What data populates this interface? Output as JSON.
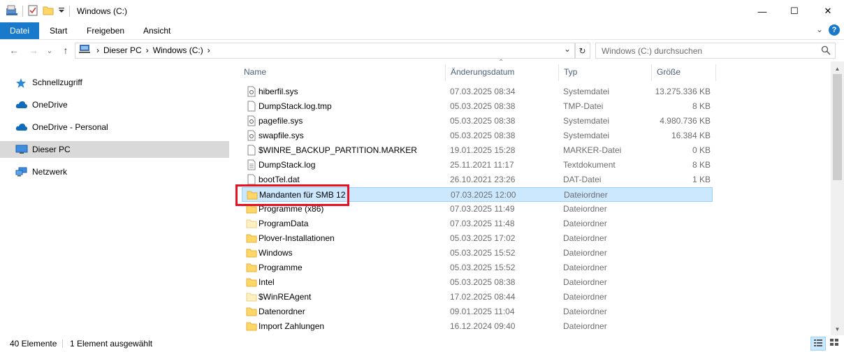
{
  "window": {
    "title": "Windows (C:)",
    "minimize_glyph": "—",
    "maximize_glyph": "☐",
    "close_glyph": "✕"
  },
  "ribbon": {
    "tabs": [
      {
        "label": "Datei",
        "active": true
      },
      {
        "label": "Start"
      },
      {
        "label": "Freigeben"
      },
      {
        "label": "Ansicht"
      }
    ],
    "expand_glyph": "⌄",
    "help_glyph": "?"
  },
  "nav": {
    "back_glyph": "←",
    "forward_glyph": "→",
    "recent_glyph": "⌄",
    "up_glyph": "↑",
    "breadcrumb": [
      "Dieser PC",
      "Windows (C:)"
    ],
    "separator": "›",
    "dropdown_glyph": "⌄",
    "refresh_glyph": "↻"
  },
  "search": {
    "placeholder": "Windows (C:) durchsuchen",
    "value": ""
  },
  "sidebar": {
    "items": [
      {
        "label": "Schnellzugriff",
        "icon": "star-icon"
      },
      {
        "label": "OneDrive",
        "icon": "cloud-icon"
      },
      {
        "label": "OneDrive - Personal",
        "icon": "cloud-icon"
      },
      {
        "label": "Dieser PC",
        "icon": "monitor-icon",
        "selected": true
      },
      {
        "label": "Netzwerk",
        "icon": "network-icon"
      }
    ]
  },
  "columns": {
    "name": "Name",
    "date": "Änderungsdatum",
    "type": "Typ",
    "size": "Größe",
    "sort_glyph": "⌃"
  },
  "files": [
    {
      "name": "hiberfil.sys",
      "date": "07.03.2025 08:34",
      "type": "Systemdatei",
      "size": "13.275.336 KB",
      "kind": "sys"
    },
    {
      "name": "DumpStack.log.tmp",
      "date": "05.03.2025 08:38",
      "type": "TMP-Datei",
      "size": "8 KB",
      "kind": "file"
    },
    {
      "name": "pagefile.sys",
      "date": "05.03.2025 08:38",
      "type": "Systemdatei",
      "size": "4.980.736 KB",
      "kind": "sys"
    },
    {
      "name": "swapfile.sys",
      "date": "05.03.2025 08:38",
      "type": "Systemdatei",
      "size": "16.384 KB",
      "kind": "sys"
    },
    {
      "name": "$WINRE_BACKUP_PARTITION.MARKER",
      "date": "19.01.2025 15:28",
      "type": "MARKER-Datei",
      "size": "0 KB",
      "kind": "file"
    },
    {
      "name": "DumpStack.log",
      "date": "25.11.2021 11:17",
      "type": "Textdokument",
      "size": "8 KB",
      "kind": "text"
    },
    {
      "name": "bootTel.dat",
      "date": "26.10.2021 23:26",
      "type": "DAT-Datei",
      "size": "1 KB",
      "kind": "file"
    },
    {
      "name": "Mandanten für SMB 12",
      "date": "07.03.2025 12:00",
      "type": "Dateiordner",
      "size": "",
      "kind": "folder",
      "selected": true
    },
    {
      "name": "Programme (x86)",
      "date": "07.03.2025 11:49",
      "type": "Dateiordner",
      "size": "",
      "kind": "folder"
    },
    {
      "name": "ProgramData",
      "date": "07.03.2025 11:48",
      "type": "Dateiordner",
      "size": "",
      "kind": "folder-light"
    },
    {
      "name": "Plover-Installationen",
      "date": "05.03.2025 17:02",
      "type": "Dateiordner",
      "size": "",
      "kind": "folder"
    },
    {
      "name": "Windows",
      "date": "05.03.2025 15:52",
      "type": "Dateiordner",
      "size": "",
      "kind": "folder"
    },
    {
      "name": "Programme",
      "date": "05.03.2025 15:52",
      "type": "Dateiordner",
      "size": "",
      "kind": "folder"
    },
    {
      "name": "Intel",
      "date": "05.03.2025 08:38",
      "type": "Dateiordner",
      "size": "",
      "kind": "folder"
    },
    {
      "name": "$WinREAgent",
      "date": "17.02.2025 08:44",
      "type": "Dateiordner",
      "size": "",
      "kind": "folder-light"
    },
    {
      "name": "Datenordner",
      "date": "09.01.2025 11:04",
      "type": "Dateiordner",
      "size": "",
      "kind": "folder"
    },
    {
      "name": "Import Zahlungen",
      "date": "16.12.2024 09:40",
      "type": "Dateiordner",
      "size": "",
      "kind": "folder"
    }
  ],
  "scrollbar": {
    "up_glyph": "▲",
    "down_glyph": "▼"
  },
  "status": {
    "count": "40 Elemente",
    "selection": "1 Element ausgewählt"
  },
  "colors": {
    "accent": "#1979ca",
    "selection": "#cce8ff",
    "highlight": "#e81123",
    "folder": "#ffd766"
  }
}
